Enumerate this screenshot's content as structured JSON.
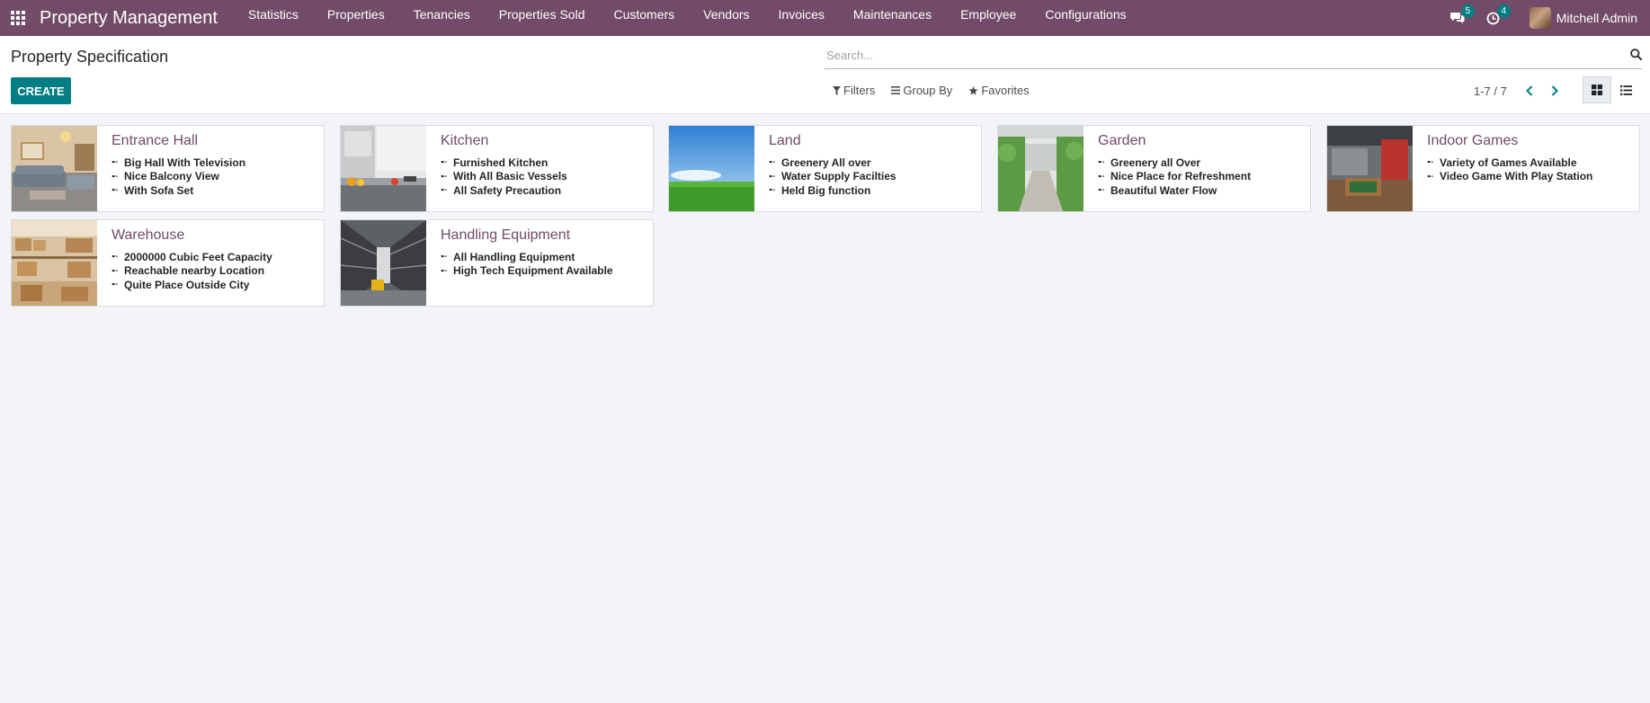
{
  "navbar": {
    "brand": "Property Management",
    "menu": [
      {
        "label": "Statistics"
      },
      {
        "label": "Properties"
      },
      {
        "label": "Tenancies"
      },
      {
        "label": "Properties Sold"
      },
      {
        "label": "Customers"
      },
      {
        "label": "Vendors"
      },
      {
        "label": "Invoices"
      },
      {
        "label": "Maintenances"
      },
      {
        "label": "Employee"
      },
      {
        "label": "Configurations"
      }
    ],
    "messages_count": "5",
    "activities_count": "4",
    "user_name": "Mitchell Admin",
    "color": "#714b67"
  },
  "control_panel": {
    "title": "Property Specification",
    "create_label": "CREATE",
    "search_placeholder": "Search...",
    "filters_label": "Filters",
    "group_by_label": "Group By",
    "favorites_label": "Favorites",
    "pager_value": "1-7 / 7",
    "accent_color": "#017e84"
  },
  "cards": [
    {
      "title": "Entrance Hall",
      "image": "living-room-photo",
      "features": [
        "Big Hall With Television",
        "Nice Balcony View",
        "With Sofa Set"
      ]
    },
    {
      "title": "Kitchen",
      "image": "kitchen-photo",
      "features": [
        "Furnished Kitchen",
        "With All Basic Vessels",
        "All Safety Precaution"
      ]
    },
    {
      "title": "Land",
      "image": "green-field-photo",
      "features": [
        "Greenery All over",
        "Water Supply Facilties",
        "Held Big function"
      ]
    },
    {
      "title": "Garden",
      "image": "garden-path-photo",
      "features": [
        "Greenery all Over",
        "Nice Place for Refreshment",
        "Beautiful Water Flow"
      ]
    },
    {
      "title": "Indoor Games",
      "image": "game-room-photo",
      "features": [
        "Variety of Games Available",
        "Video Game With Play Station"
      ]
    },
    {
      "title": "Warehouse",
      "image": "warehouse-boxes-photo",
      "features": [
        "2000000 Cubic Feet Capacity",
        "Reachable nearby Location",
        "Quite Place Outside City"
      ]
    },
    {
      "title": "Handling Equipment",
      "image": "forklift-aisle-photo",
      "features": [
        "All Handling Equipment",
        "High Tech Equipment Available"
      ]
    }
  ]
}
